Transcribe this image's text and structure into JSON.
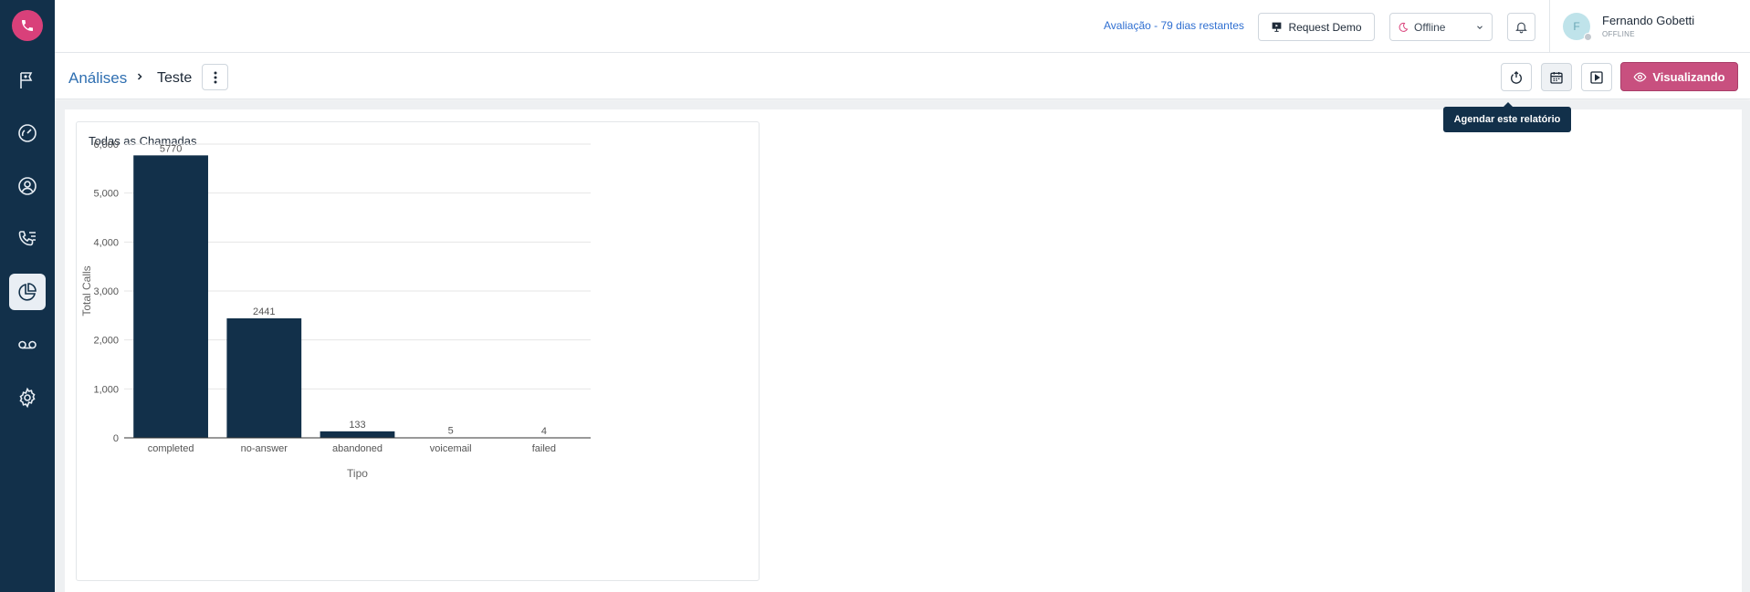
{
  "header": {
    "trial_text": "Avaliação - 79 dias restantes",
    "request_demo_label": "Request Demo",
    "status_value": "Offline",
    "user": {
      "name": "Fernando Gobetti",
      "status": "OFFLINE",
      "initial": "F"
    }
  },
  "breadcrumb": {
    "root": "Análises",
    "current": "Teste"
  },
  "actions": {
    "view_label": "Visualizando",
    "tooltip": "Agendar este relatório"
  },
  "sidebar": {
    "items": [
      "phone-logo",
      "flag-icon",
      "gauge-icon",
      "user-icon",
      "call-list-icon",
      "pie-chart-icon",
      "voicemail-icon",
      "gear-icon"
    ]
  },
  "colors": {
    "sidebar": "#12304a",
    "accent": "#c8507f",
    "bar": "#12304a"
  },
  "chart": {
    "card_title": "Todas as Chamadas",
    "chart_data": {
      "type": "bar",
      "title": "Todas as Chamadas",
      "categories": [
        "completed",
        "no-answer",
        "abandoned",
        "voicemail",
        "failed"
      ],
      "values": [
        5770,
        2441,
        133,
        5,
        4
      ],
      "data_labels": [
        "5770",
        "2441",
        "133",
        "5",
        "4"
      ],
      "xlabel": "Tipo",
      "ylabel": "Total Calls",
      "ylim": [
        0,
        6000
      ],
      "yticks": [
        0,
        1000,
        2000,
        3000,
        4000,
        5000,
        6000
      ],
      "ytick_labels": [
        "0",
        "1,000",
        "2,000",
        "3,000",
        "4,000",
        "5,000",
        "6,000"
      ],
      "grid": true
    }
  }
}
